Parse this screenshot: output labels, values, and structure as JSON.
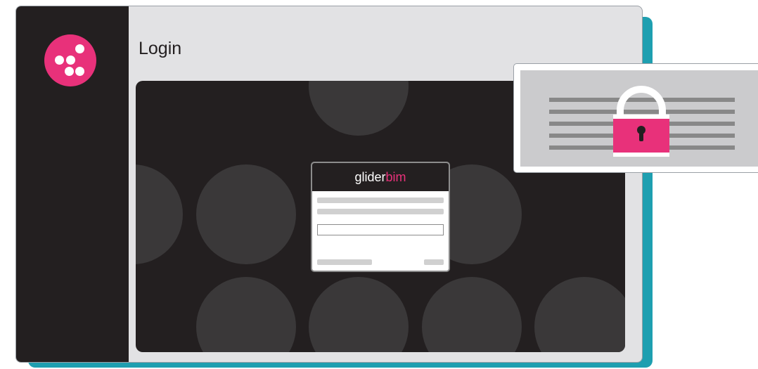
{
  "page": {
    "title": "Login"
  },
  "brand": {
    "name_part1": "glider",
    "name_part2": "bim",
    "accent_color": "#e8317a",
    "dark_color": "#231f20",
    "teal_color": "#1e9fb0"
  },
  "icons": {
    "logo": "dots-logo-icon",
    "security": "padlock-icon"
  }
}
